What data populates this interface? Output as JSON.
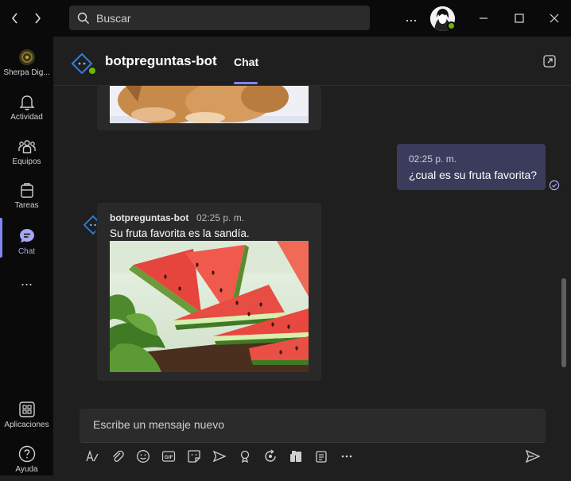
{
  "titlebar": {
    "search_placeholder": "Buscar",
    "more_label": "..."
  },
  "rail": {
    "org_label": "Sherpa Dig...",
    "items": [
      {
        "label": "Actividad",
        "icon": "bell-icon"
      },
      {
        "label": "Equipos",
        "icon": "teams-icon"
      },
      {
        "label": "Tareas",
        "icon": "tasks-icon"
      },
      {
        "label": "Chat",
        "icon": "chat-icon",
        "active": true
      }
    ],
    "more_label": "...",
    "apps_label": "Aplicaciones",
    "help_label": "Ayuda"
  },
  "header": {
    "title": "botpreguntas-bot",
    "tab_label": "Chat"
  },
  "messages": {
    "my_message": {
      "time": "02:25 p. m.",
      "text": "¿cual es su fruta favorita?"
    },
    "bot_message": {
      "sender": "botpreguntas-bot",
      "time": "02:25 p. m.",
      "text": "Su fruta favorita es la sandía."
    }
  },
  "compose": {
    "placeholder": "Escribe un mensaje nuevo"
  },
  "colors": {
    "accent": "#7f85f5",
    "presence": "#6bb700",
    "my_bubble": "#3b3c5b"
  }
}
